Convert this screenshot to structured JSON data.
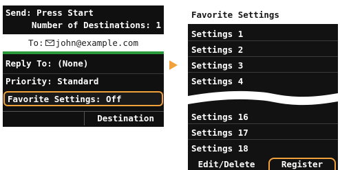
{
  "left_screen": {
    "send_title": "Send: Press Start",
    "destination_count": "Number of Destinations: 1",
    "to_label": "To:",
    "to_address": "john@example.com",
    "reply_to": "Reply To: (None)",
    "priority": "Priority: Standard",
    "favorite_settings": "Favorite Settings: Off",
    "destination_button": "Destination"
  },
  "right_screen": {
    "title": "Favorite Settings",
    "items": [
      "Settings 1",
      "Settings 2",
      "Settings 3",
      "Settings 4",
      "Settings 16",
      "Settings 17",
      "Settings 18"
    ],
    "edit_delete_button": "Edit/Delete",
    "register_button": "Register"
  },
  "colors": {
    "highlight": "#f2a23a",
    "arrow": "#f2a23a",
    "to_underline": "#2a9a3a"
  },
  "icons": {
    "to_address_icon": "envelope-icon",
    "transition_arrow": "arrow-right-icon"
  }
}
